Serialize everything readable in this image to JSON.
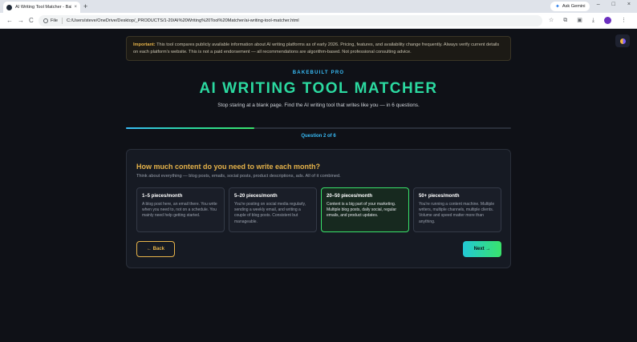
{
  "browser": {
    "tab_title": "AI Writing Tool Matcher - Bake",
    "tab_close": "×",
    "new_tab": "+",
    "ask_gemini": "Ask Gemini",
    "window_controls": [
      "–",
      "□",
      "×"
    ],
    "nav": {
      "back": "←",
      "forward": "→",
      "reload": "C"
    },
    "file_label": "File",
    "url": "C:/Users/steve/OneDrive/Desktop/_PRODUCTS/1-20/AI%20Writing%20Tool%20Matcher/ai-writing-tool-matcher.html",
    "profile_initial": "S"
  },
  "notice": {
    "label": "Important:",
    "text": " This tool compares publicly available information about AI writing platforms as of early 2026. Pricing, features, and availability change frequently. Always verify current details on each platform's website. This is not a paid endorsement — all recommendations are algorithm-based. Not professional consulting advice."
  },
  "brand": "BAKEBUILT PRO",
  "title": "AI WRITING TOOL MATCHER",
  "subtitle": "Stop staring at a blank page. Find the AI writing tool that writes like you — in 6 questions.",
  "progress": {
    "current": 2,
    "total": 6,
    "label": "Question 2 of 6"
  },
  "question": {
    "title": "How much content do you need to write each month?",
    "hint": "Think about everything — blog posts, emails, social posts, product descriptions, ads. All of it combined.",
    "options": [
      {
        "title": "1–5 pieces/month",
        "desc": "A blog post here, an email there. You write when you need to, not on a schedule. You mainly need help getting started.",
        "selected": false
      },
      {
        "title": "5–20 pieces/month",
        "desc": "You're posting on social media regularly, sending a weekly email, and writing a couple of blog posts. Consistent but manageable.",
        "selected": false
      },
      {
        "title": "20–50 pieces/month",
        "desc": "Content is a big part of your marketing. Multiple blog posts, daily social, regular emails, and product updates.",
        "selected": true
      },
      {
        "title": "50+ pieces/month",
        "desc": "You're running a content machine. Multiple writers, multiple channels, multiple clients. Volume and speed matter more than anything.",
        "selected": false
      }
    ]
  },
  "buttons": {
    "back": "← Back",
    "next": "Next →"
  },
  "colors": {
    "accent_gold": "#e6b34a",
    "accent_teal": "#2bd9a0",
    "accent_blue": "#38bdf8",
    "selected_green": "#39e36b",
    "background": "#0f1117"
  }
}
